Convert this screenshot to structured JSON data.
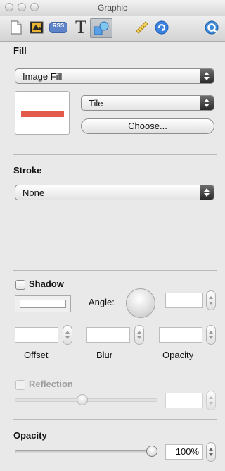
{
  "window": {
    "title": "Graphic"
  },
  "toolbar": {
    "icons": [
      "document-icon",
      "image-icon",
      "rss-icon",
      "text-icon",
      "graphic-icon",
      "ruler-icon",
      "link-icon",
      "quicktime-icon"
    ],
    "rss_label": "RSS",
    "text_glyph": "T",
    "active": "graphic-icon"
  },
  "fill": {
    "title": "Fill",
    "type_value": "Image Fill",
    "mode_value": "Tile",
    "choose_label": "Choose...",
    "swatch_color": "#e45a4a"
  },
  "stroke": {
    "title": "Stroke",
    "value": "None"
  },
  "shadow": {
    "label": "Shadow",
    "checked": false,
    "angle_label": "Angle:",
    "angle_value": "",
    "offset_label": "Offset",
    "blur_label": "Blur",
    "opacity_label": "Opacity",
    "offset_value": "",
    "blur_value": "",
    "opacity_value": ""
  },
  "reflection": {
    "label": "Reflection",
    "checked": false,
    "enabled": false,
    "slider_fraction": 0.47,
    "value": ""
  },
  "opacity": {
    "title": "Opacity",
    "value": "100%",
    "slider_fraction": 1.0
  }
}
